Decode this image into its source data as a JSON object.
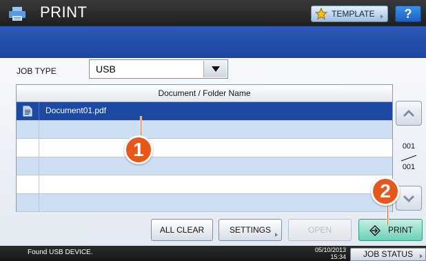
{
  "header": {
    "title": "PRINT",
    "template_label": "TEMPLATE",
    "help_label": "?"
  },
  "job_type": {
    "label": "JOB TYPE",
    "value": "USB"
  },
  "list": {
    "column_header": "Document / Folder Name",
    "rows": [
      {
        "name": "Document01.pdf",
        "icon": "document-icon",
        "selected": true
      },
      {
        "name": ""
      },
      {
        "name": ""
      },
      {
        "name": ""
      },
      {
        "name": ""
      },
      {
        "name": ""
      }
    ]
  },
  "pager": {
    "current": "001",
    "total": "001"
  },
  "buttons": {
    "all_clear": "ALL CLEAR",
    "settings": "SETTINGS",
    "open": "OPEN",
    "print": "PRINT"
  },
  "callouts": {
    "one": "1",
    "two": "2"
  },
  "status": {
    "message": "Found USB DEVICE.",
    "date": "05/10/2013",
    "time": "15:34",
    "job_status": "JOB STATUS"
  },
  "colors": {
    "accent_blue": "#1d49a3",
    "callout": "#e7561a",
    "print_button": "#6cd0b8"
  }
}
